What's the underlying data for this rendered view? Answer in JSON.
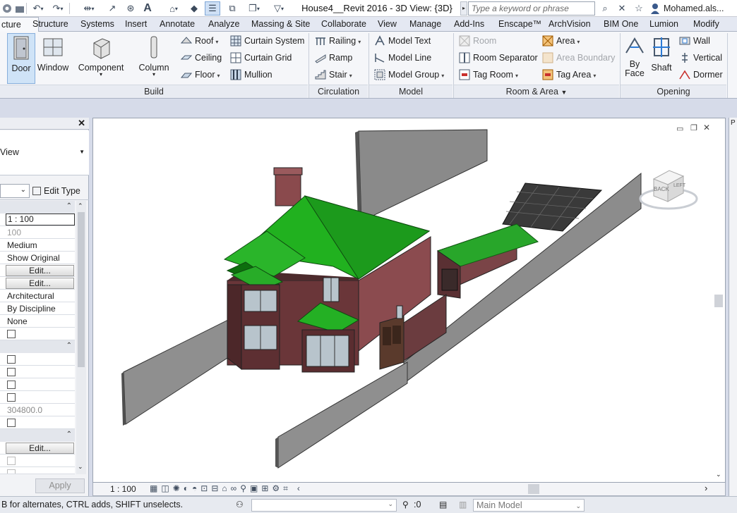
{
  "window": {
    "title": "House4__Revit 2016 - 3D View: {3D}",
    "search_placeholder": "Type a keyword or phrase",
    "user": "Mohamed.als..."
  },
  "tabs": [
    "cture",
    "Structure",
    "Systems",
    "Insert",
    "Annotate",
    "Analyze",
    "Massing & Site",
    "Collaborate",
    "View",
    "Manage",
    "Add-Ins",
    "Enscape™",
    "ArchVision",
    "BIM One",
    "Lumion",
    "Modify"
  ],
  "ribbon": {
    "build": {
      "label": "Build",
      "door": "Door",
      "window": "Window",
      "component": "Component",
      "column": "Column",
      "roof": "Roof",
      "ceiling": "Ceiling",
      "floor": "Floor",
      "curtain_system": "Curtain System",
      "curtain_grid": "Curtain Grid",
      "mullion": "Mullion"
    },
    "circulation": {
      "label": "Circulation",
      "railing": "Railing",
      "ramp": "Ramp",
      "stair": "Stair"
    },
    "model": {
      "label": "Model",
      "model_text": "Model Text",
      "model_line": "Model Line",
      "model_group": "Model Group"
    },
    "room_area": {
      "label": "Room & Area",
      "room": "Room",
      "room_separator": "Room Separator",
      "tag_room": "Tag Room",
      "area": "Area",
      "area_boundary": "Area Boundary",
      "tag_area": "Tag Area"
    },
    "opening": {
      "label": "Opening",
      "by_face": "By Face",
      "by_face_2": "Face",
      "by_face_1": "By",
      "shaft": "Shaft",
      "wall": "Wall",
      "vertical": "Vertical",
      "dormer": "Dormer"
    }
  },
  "properties": {
    "type_label": "View",
    "edit_type": "Edit Type",
    "rows": {
      "scale": "1 : 100",
      "scale_value": "100",
      "detail_level": "Medium",
      "parts_visibility": "Show Original",
      "vg_edit": "Edit...",
      "graphic_edit": "Edit...",
      "discipline": "Architectural",
      "show_hidden": "By Discipline",
      "default_analysis": "None",
      "eye_elevation": "304800.0",
      "section_edit": "Edit..."
    },
    "apply": "Apply"
  },
  "viewbar": {
    "scale": "1 : 100"
  },
  "viewcube": {
    "face": "BACK",
    "side": "LEFT"
  },
  "statusbar": {
    "hint": "B for alternates, CTRL adds, SHIFT unselects.",
    "count": ":0",
    "model": "Main Model"
  }
}
